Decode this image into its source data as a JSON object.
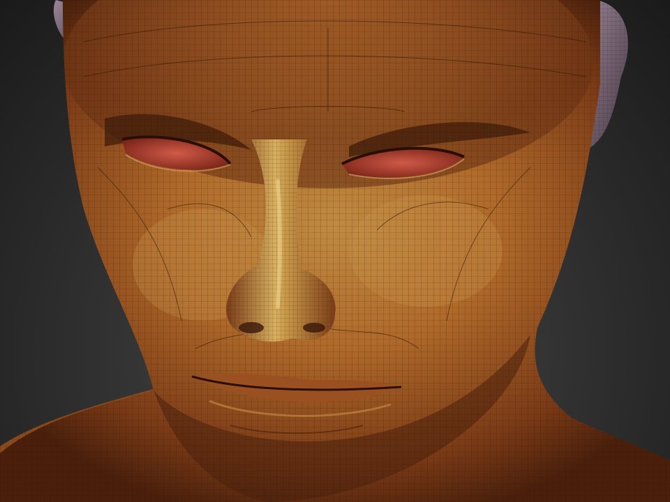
{
  "viewport": {
    "subject": "sculpted-head-wireframe",
    "colors": {
      "background_center": "#4a4a4a",
      "background_edge": "#1a1a1a",
      "skin_light": "#c89a4a",
      "skin_mid": "#a85c22",
      "skin_dark": "#5a2a10",
      "eye_red": "#c0443a",
      "ear_grey": "#7a6a78",
      "wire": "#2a1a0a"
    }
  }
}
